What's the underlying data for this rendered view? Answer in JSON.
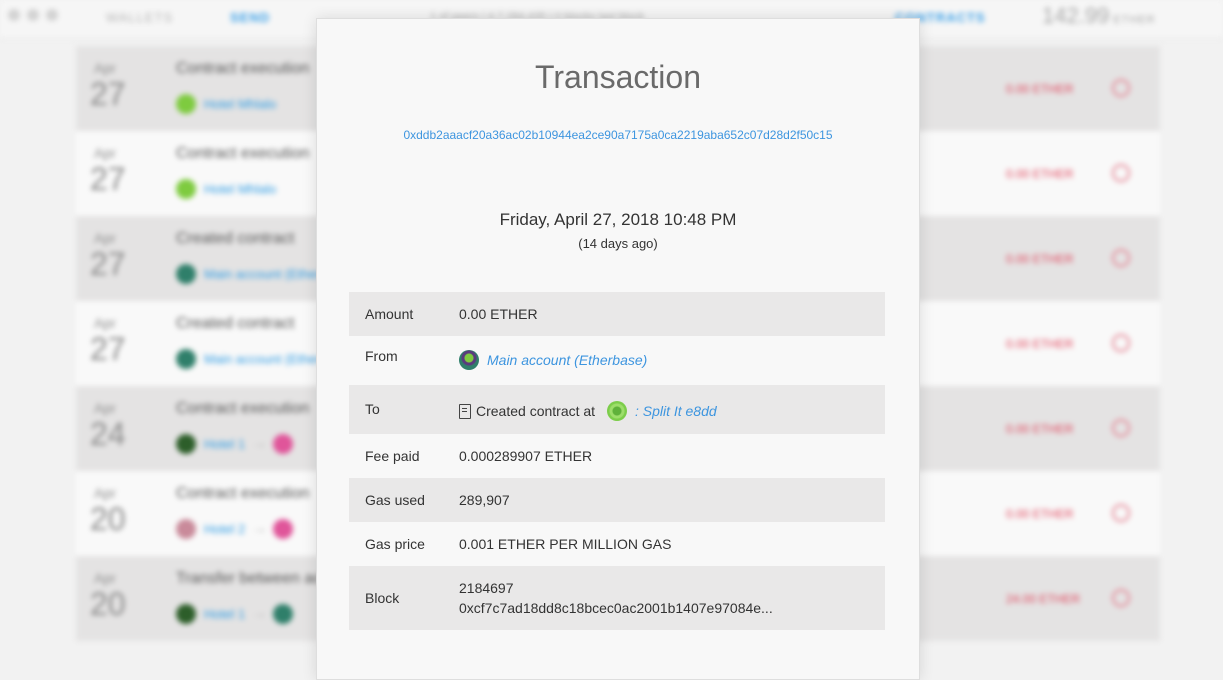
{
  "app": {
    "nav": {
      "wallets": "WALLETS",
      "send": "SEND",
      "contracts": "CONTRACTS"
    },
    "peer_info": "1 of peers  |  4,7,284,435  |  0 blocks last block",
    "balance": {
      "amount": "142.99",
      "unit": "ETHER"
    }
  },
  "transactions": [
    {
      "month": "Apr",
      "day": "27",
      "title": "Contract execution",
      "from": "Hotel Mhlalo",
      "to": "",
      "amount": "0.00 ETHER",
      "from_color": "#7ecb3f",
      "to_color": ""
    },
    {
      "month": "Apr",
      "day": "27",
      "title": "Contract execution",
      "from": "Hotel Mhlalo",
      "to": "",
      "amount": "0.00 ETHER",
      "from_color": "#7ecb3f",
      "to_color": ""
    },
    {
      "month": "Apr",
      "day": "27",
      "title": "Created contract",
      "from": "Main account (Ether",
      "to": "",
      "amount": "0.00 ETHER",
      "from_color": "#2f7f6a",
      "to_color": ""
    },
    {
      "month": "Apr",
      "day": "27",
      "title": "Created contract",
      "from": "Main account (Ether",
      "to": "",
      "amount": "0.00 ETHER",
      "from_color": "#2f7f6a",
      "to_color": ""
    },
    {
      "month": "Apr",
      "day": "24",
      "title": "Contract execution",
      "from": "Hotel 1",
      "to": "",
      "amount": "0.00 ETHER",
      "from_color": "#2d5e2a",
      "to_color": "#e0559a"
    },
    {
      "month": "Apr",
      "day": "20",
      "title": "Contract execution",
      "from": "Hotel 2",
      "to": "",
      "amount": "0.00 ETHER",
      "from_color": "#c98a9a",
      "to_color": "#e0559a"
    },
    {
      "month": "Apr",
      "day": "20",
      "title": "Transfer between accounts",
      "from": "Hotel 1",
      "to": "",
      "amount": "24.00 ETHER",
      "from_color": "#2d5e2a",
      "to_color": "#2f7f6a"
    }
  ],
  "modal": {
    "title": "Transaction",
    "hash": "0xddb2aaacf20a36ac02b10944ea2ce90a7175a0ca2219aba652c07d28d2f50c15",
    "date": "Friday, April 27, 2018 10:48 PM",
    "ago": "(14 days ago)",
    "amount": {
      "label": "Amount",
      "value": "0.00 ETHER"
    },
    "from": {
      "label": "From",
      "value": "Main account (Etherbase)"
    },
    "to": {
      "label": "To",
      "prefix": "Created contract at",
      "value": ": Split It e8dd"
    },
    "fee": {
      "label": "Fee paid",
      "value": "0.000289907 ETHER"
    },
    "gas_used": {
      "label": "Gas used",
      "value": "289,907"
    },
    "gas_price": {
      "label": "Gas price",
      "value": "0.001 ETHER PER MILLION GAS"
    },
    "block": {
      "label": "Block",
      "number": "2184697",
      "hash": "0xcf7c7ad18dd8c18bcec0ac2001b1407e97084e..."
    }
  }
}
